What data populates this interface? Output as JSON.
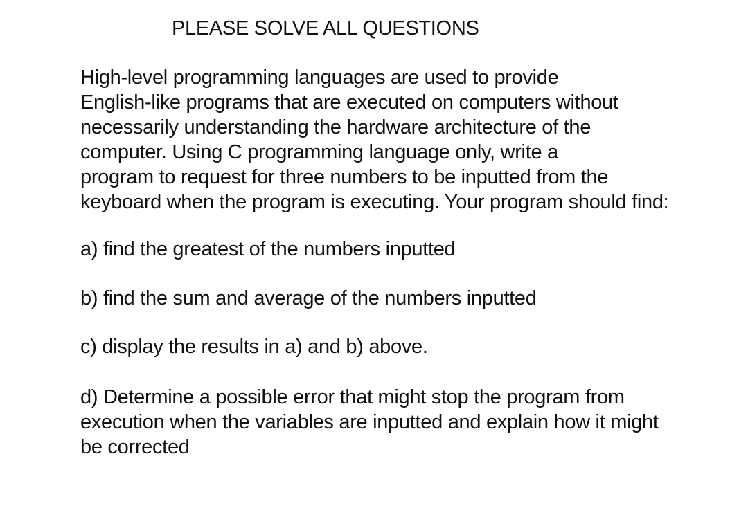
{
  "document": {
    "title": "PLEASE SOLVE ALL QUESTIONS",
    "intro_lines": [
      "High-level programming languages are used to provide",
      "English-like programs that are executed on computers without",
      "necessarily understanding the hardware architecture of the",
      "computer. Using C programming language only, write a",
      "program to request for three numbers to be inputted from the",
      "keyboard when the program is executing. Your program should find:"
    ],
    "items": [
      {
        "lines": [
          "a) find the greatest of the numbers inputted"
        ]
      },
      {
        "lines": [
          "b) find the sum and average of the numbers inputted"
        ]
      },
      {
        "lines": [
          "c) display the results in a) and b) above."
        ]
      },
      {
        "lines": [
          "d) Determine a possible error that might stop the program from",
          "execution when the variables are inputted and explain how it might",
          "be corrected"
        ]
      }
    ]
  }
}
